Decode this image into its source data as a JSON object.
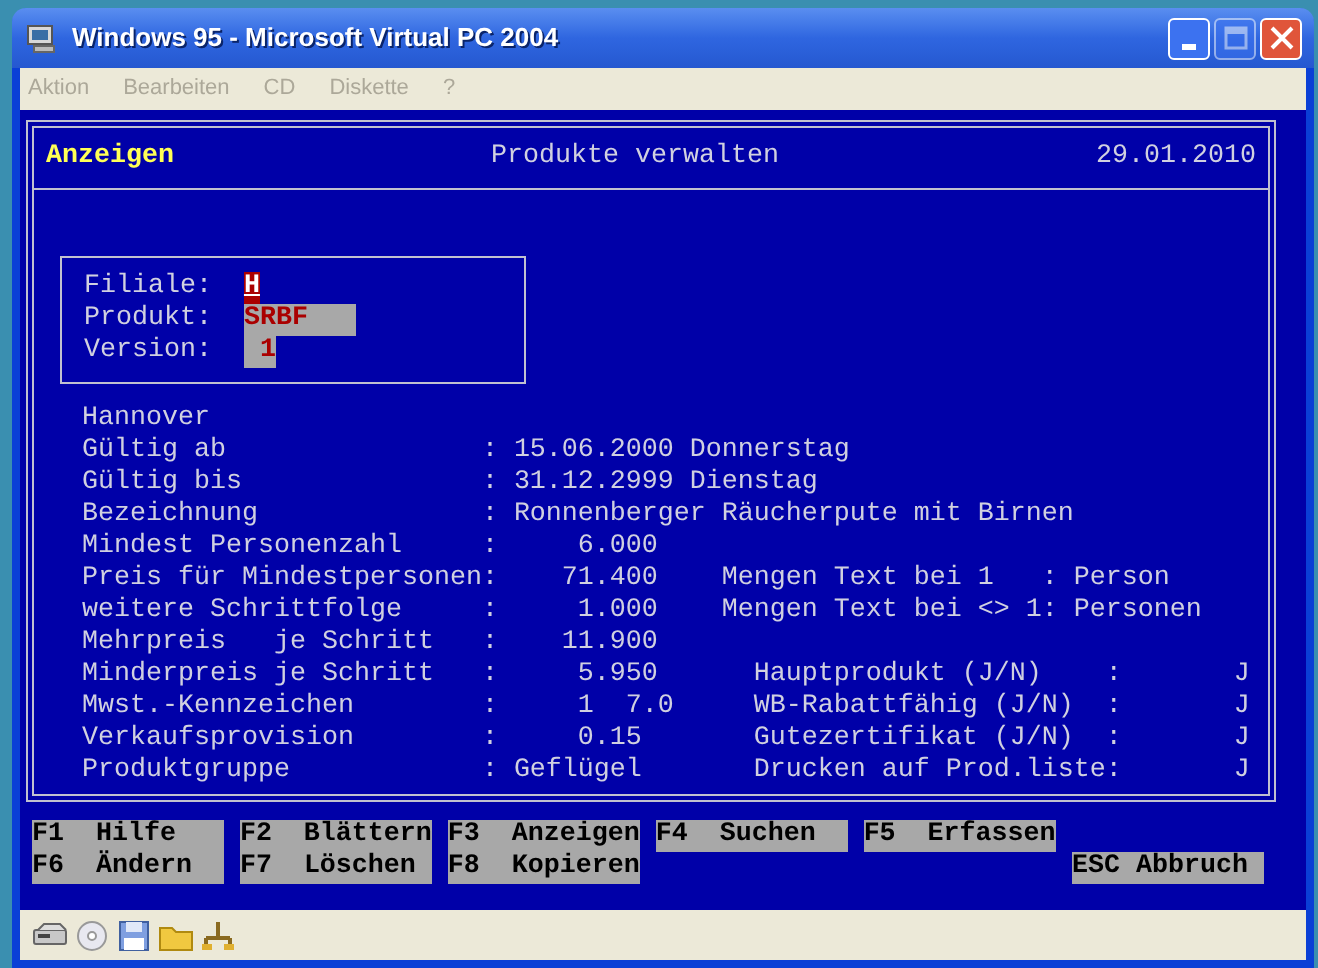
{
  "window": {
    "title": "Windows 95 - Microsoft Virtual PC 2004",
    "controls": [
      {
        "kind": "minimize",
        "disabled": false
      },
      {
        "kind": "maximize",
        "disabled": true
      },
      {
        "kind": "close",
        "disabled": false
      }
    ]
  },
  "menu": [
    {
      "label": "Aktion",
      "disabled": true
    },
    {
      "label": "Bearbeiten",
      "disabled": true
    },
    {
      "label": "CD",
      "disabled": true
    },
    {
      "label": "Diskette",
      "disabled": true
    },
    {
      "label": "?",
      "disabled": true
    }
  ],
  "screen": {
    "mode": "Anzeigen",
    "title": "Produkte verwalten",
    "date": "29.01.2010",
    "key_fields": [
      {
        "label": "Filiale:",
        "value": "H",
        "focused": true
      },
      {
        "label": "Produkt:",
        "value": "SRBF",
        "focused": false
      },
      {
        "label": "Version:",
        "value": "1",
        "focused": false
      }
    ],
    "rows": [
      {
        "label": "Hannover"
      },
      {
        "label": "Gültig ab",
        "colon": ":",
        "value": "15.06.2000 Donnerstag",
        "kind": "text"
      },
      {
        "label": "Gültig bis",
        "colon": ":",
        "value": "31.12.2999 Dienstag",
        "kind": "text"
      },
      {
        "label": "Bezeichnung",
        "colon": ":",
        "value": "Ronnenberger Räucherpute mit Birnen",
        "kind": "text"
      },
      {
        "label": "Mindest Personenzahl",
        "colon": ":",
        "value": "6.000",
        "kind": "number"
      },
      {
        "label": "Preis für Mindestpersonen",
        "colon": ":",
        "value": "71.400",
        "kind": "number",
        "right": {
          "kind": "quantity",
          "label": "Mengen Text bei 1",
          "colon": ":",
          "value": "Person"
        }
      },
      {
        "label": "weitere Schrittfolge",
        "colon": ":",
        "value": "1.000",
        "kind": "number",
        "right": {
          "kind": "quantity",
          "label": "Mengen Text bei <> 1",
          "colon": ":",
          "value": "Personen"
        }
      },
      {
        "label": "Mehrpreis   je Schritt",
        "colon": ":",
        "value": "11.900",
        "kind": "number"
      },
      {
        "label": "Minderpreis je Schritt",
        "colon": ":",
        "value": "5.950",
        "kind": "number",
        "right": {
          "kind": "flag",
          "label": "Hauptprodukt (J/N)",
          "colon": ":",
          "value": "J"
        }
      },
      {
        "label": "Mwst.-Kennzeichen",
        "colon": ":",
        "value": "1",
        "rate": "7.0",
        "kind": "code",
        "right": {
          "kind": "flag",
          "label": "WB-Rabattfähig (J/N)",
          "colon": ":",
          "value": "J"
        }
      },
      {
        "label": "Verkaufsprovision",
        "colon": ":",
        "value": "0.15",
        "kind": "decimal",
        "right": {
          "kind": "flag",
          "label": "Gutezertifikat (J/N)",
          "colon": ":",
          "value": "J"
        }
      },
      {
        "label": "Produktgruppe",
        "colon": ":",
        "value": "Geflügel",
        "kind": "text",
        "right": {
          "kind": "flag",
          "label": "Drucken auf Prod.liste",
          "colon": ":",
          "value": "J"
        }
      }
    ]
  },
  "function_keys": [
    [
      {
        "key": "F1",
        "label": "Hilfe",
        "kind": "fkey"
      },
      {
        "key": "F2",
        "label": "Blättern",
        "kind": "fkey"
      },
      {
        "key": "F3",
        "label": "Anzeigen",
        "kind": "fkey"
      },
      {
        "key": "F4",
        "label": "Suchen",
        "kind": "fkey"
      },
      {
        "key": "F5",
        "label": "Erfassen",
        "kind": "fkey"
      }
    ],
    [
      {
        "key": "F6",
        "label": "Ändern",
        "kind": "fkey"
      },
      {
        "key": "F7",
        "label": "Löschen",
        "kind": "fkey"
      },
      {
        "key": "F8",
        "label": "Kopieren",
        "kind": "fkey"
      },
      {
        "key": "ESC",
        "label": "Abbruch",
        "kind": "escape"
      }
    ]
  ],
  "status_icons": [
    {
      "kind": "harddisk"
    },
    {
      "kind": "cd"
    },
    {
      "kind": "floppy"
    },
    {
      "kind": "folder"
    },
    {
      "kind": "network"
    }
  ]
}
